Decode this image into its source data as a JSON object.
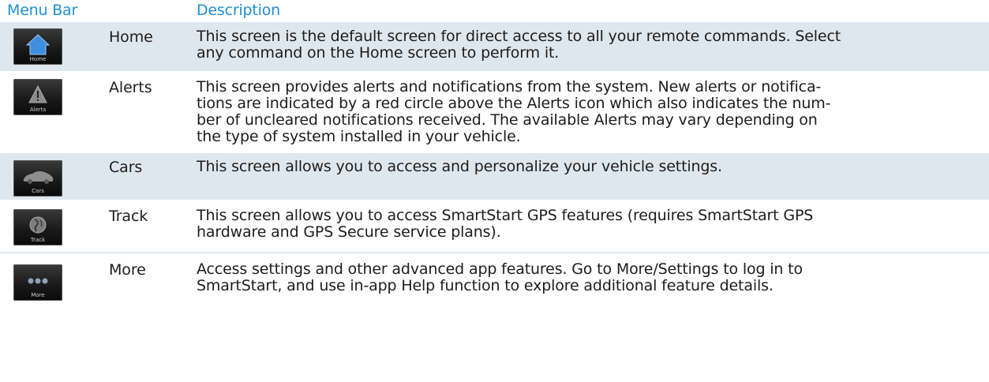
{
  "header": {
    "col1": "Menu Bar",
    "col2": "Description"
  },
  "colors": {
    "header_text": "#1f8fd0",
    "row_band": "#dfe7ee",
    "body_text": "#1c1c1c"
  },
  "rows": [
    {
      "name": "Home",
      "icon": "home-icon",
      "icon_caption": "Home",
      "lines": [
        "This screen is the default screen for direct access to all your remote commands. Select",
        "any command on the Home screen to perform it."
      ]
    },
    {
      "name": "Alerts",
      "icon": "alert-icon",
      "icon_caption": "Alerts",
      "lines": [
        "This screen provides alerts and notifications from the system. New alerts or notifica-",
        "tions are indicated by a red circle above the Alerts icon which also indicates the num-",
        "ber of uncleared notifications received. The available Alerts may vary depending on",
        "the type of system installed in your vehicle."
      ]
    },
    {
      "name": "Cars",
      "icon": "car-icon",
      "icon_caption": "Cars",
      "lines": [
        "This screen allows you to access and personalize your vehicle settings."
      ]
    },
    {
      "name": "Track",
      "icon": "globe-icon",
      "icon_caption": "Track",
      "lines": [
        "This screen allows you to access SmartStart GPS features (requires SmartStart GPS",
        "hardware and GPS Secure service plans)."
      ]
    },
    {
      "name": "More",
      "icon": "more-dots-icon",
      "icon_caption": "More",
      "lines": [
        "Access settings and other advanced app features. Go to More/Settings to log in to",
        "SmartStart, and use in-app Help function to explore additional feature details."
      ]
    }
  ]
}
